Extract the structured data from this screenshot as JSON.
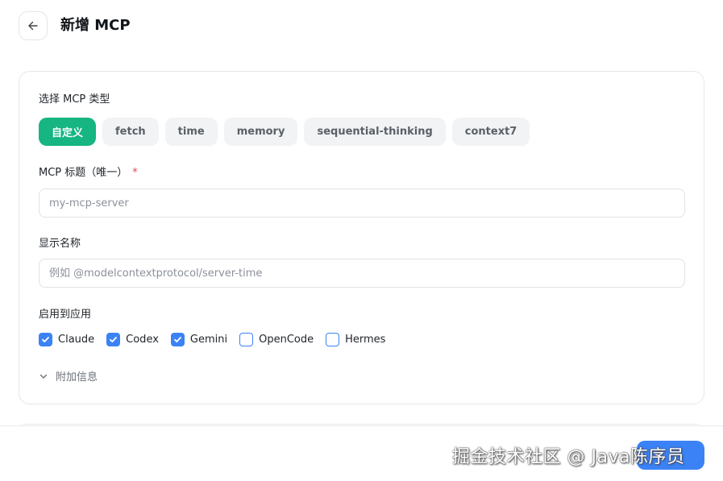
{
  "header": {
    "title": "新增 MCP"
  },
  "type_section": {
    "label": "选择 MCP 类型",
    "chips": [
      "自定义",
      "fetch",
      "time",
      "memory",
      "sequential-thinking",
      "context7"
    ],
    "selected": "自定义"
  },
  "title_field": {
    "label": "MCP 标题（唯一）",
    "required_mark": "*",
    "value": "",
    "placeholder": "my-mcp-server"
  },
  "display_name_field": {
    "label": "显示名称",
    "value": "",
    "placeholder": "例如 @modelcontextprotocol/server-time"
  },
  "apps_section": {
    "label": "启用到应用",
    "apps": [
      {
        "name": "Claude",
        "checked": true
      },
      {
        "name": "Codex",
        "checked": true
      },
      {
        "name": "Gemini",
        "checked": true
      },
      {
        "name": "OpenCode",
        "checked": false
      },
      {
        "name": "Hermes",
        "checked": false
      }
    ]
  },
  "extra_info": {
    "label": "附加信息"
  },
  "footer": {
    "watermark": "掘金技术社区 @ Java陈序员"
  },
  "colors": {
    "accent_green": "#16b582",
    "accent_blue": "#3b82f6",
    "required_red": "#e5484d"
  }
}
